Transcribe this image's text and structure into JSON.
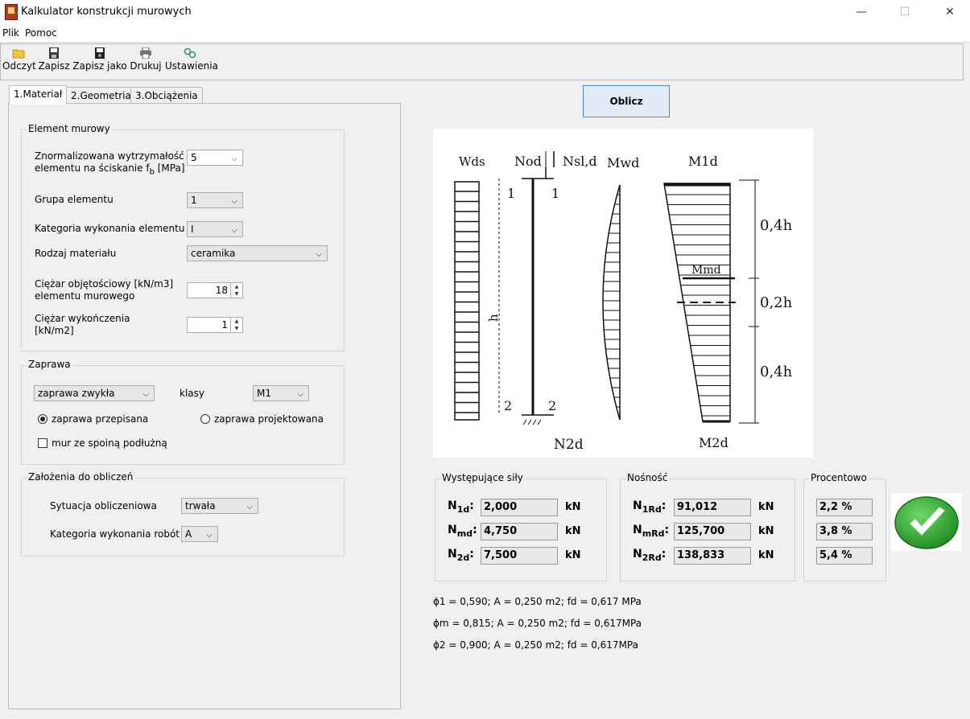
{
  "window": {
    "title": "Kalkulator konstrukcji murowych",
    "minimize": "—",
    "maximize": "☐",
    "close": "✕"
  },
  "menu": [
    "Plik",
    "Pomoc"
  ],
  "toolbar": [
    {
      "label": "Odczyt",
      "icon": "folder-open-icon",
      "color": "#f2c23a"
    },
    {
      "label": "Zapisz",
      "icon": "save-icon",
      "color": "#3b3b3b"
    },
    {
      "label": "Zapisz jako",
      "icon": "save-as-icon",
      "color": "#222222"
    },
    {
      "label": "Drukuj",
      "icon": "printer-icon",
      "color": "#555555"
    },
    {
      "label": "Ustawienia",
      "icon": "settings-icon",
      "color": "#3a8a7a"
    }
  ],
  "tabs": [
    {
      "label": "1.Materiał",
      "active": true
    },
    {
      "label": "2.Geometria",
      "active": false
    },
    {
      "label": "3.Obciążenia",
      "active": false
    }
  ],
  "element_murowy": {
    "title": "Element murowy",
    "wytrzymalosc_label_1": "Znormalizowana wytrzymałość",
    "wytrzymalosc_label_2": "elementu na ściskanie f",
    "wytrzymalosc_label_sub": "b",
    "wytrzymalosc_label_3": " [MPa]",
    "wytrzymalosc_value": "5",
    "grupa_label": "Grupa elementu",
    "grupa_value": "1",
    "kategoria_label": "Kategoria wykonania elementu",
    "kategoria_value": "I",
    "rodzaj_label": "Rodzaj materiału",
    "rodzaj_value": "ceramika",
    "ciezar_obj_label_1": "Ciężar objętościowy [kN/m3]",
    "ciezar_obj_label_2": "elementu murowego",
    "ciezar_obj_value": "18",
    "ciezar_wyk_label_1": "Ciężar wykończenia",
    "ciezar_wyk_label_2": "[kN/m2]",
    "ciezar_wyk_value": "1"
  },
  "zaprawa": {
    "title": "Zaprawa",
    "typ_value": "zaprawa zwykła",
    "klasy_label": "klasy",
    "klasa_value": "M1",
    "radio_przepisana": "zaprawa przepisana",
    "radio_projektowana": "zaprawa projektowana",
    "selected": "przepisana",
    "checkbox_label": "mur ze spoiną podłużną",
    "checkbox_checked": false
  },
  "zalozenia": {
    "title": "Założenia do obliczeń",
    "sytuacja_label": "Sytuacja obliczeniowa",
    "sytuacja_value": "trwała",
    "kategoria_robot_label": "Kategoria wykonania robót",
    "kategoria_robot_value": "A"
  },
  "calc_button": "Oblicz",
  "diagram": {
    "wds": "Wds",
    "nod": "Nod",
    "nsld": "Nsl,d",
    "mwd": "Mwd",
    "m1d": "M1d",
    "mmd": "Mmd",
    "m2d": "M2d",
    "n2d": "N2d",
    "h": "h",
    "section_top_l": "1",
    "section_top_r": "1",
    "section_bot_l": "2",
    "section_bot_r": "2",
    "dim1": "0,4h",
    "dim2": "0,2h",
    "dim3": "0,4h"
  },
  "sily": {
    "title": "Występujące siły",
    "rows": [
      {
        "label": "N",
        "sub": "1d",
        "value": "2,000",
        "unit": "kN"
      },
      {
        "label": "N",
        "sub": "md",
        "value": "4,750",
        "unit": "kN"
      },
      {
        "label": "N",
        "sub": "2d",
        "value": "7,500",
        "unit": "kN"
      }
    ]
  },
  "nosnosc": {
    "title": "Nośność",
    "rows": [
      {
        "label": "N",
        "sub": "1Rd",
        "value": "91,012",
        "unit": "kN"
      },
      {
        "label": "N",
        "sub": "mRd",
        "value": "125,700",
        "unit": "kN"
      },
      {
        "label": "N",
        "sub": "2Rd",
        "value": "138,833",
        "unit": "kN"
      }
    ]
  },
  "procentowo": {
    "title": "Procentowo",
    "values": [
      "2,2 %",
      "3,8 %",
      "5,4 %"
    ]
  },
  "status_icon": "checkmark-ok-icon",
  "formulas": [
    "ϕ1 = 0,590; A = 0,250 m2; fd = 0,617 MPa",
    "ϕm = 0,815; A = 0,250 m2; fd = 0,617MPa",
    "ϕ2 = 0,900; A = 0,250 m2; fd = 0,617MPa"
  ]
}
